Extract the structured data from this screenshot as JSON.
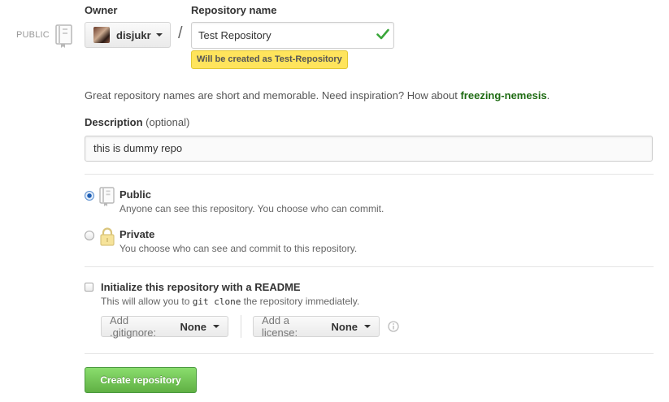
{
  "header": {
    "visibility_badge": "PUBLIC",
    "owner_label": "Owner",
    "repo_name_label": "Repository name",
    "owner_name": "disjukr",
    "slash": "/"
  },
  "repo_name": {
    "value": "Test Repository",
    "tooltip": "Will be created as Test-Repository",
    "valid": true
  },
  "hint": {
    "text": "Great repository names are short and memorable. Need inspiration? How about ",
    "suggestion": "freezing-nemesis",
    "end": "."
  },
  "description": {
    "label": "Description",
    "optional": "(optional)",
    "value": "this is dummy repo"
  },
  "visibility": {
    "public_title": "Public",
    "public_sub": "Anyone can see this repository. You choose who can commit.",
    "private_title": "Private",
    "private_sub": "You choose who can see and commit to this repository.",
    "selected": "Public"
  },
  "readme": {
    "title": "Initialize this repository with a README",
    "sub_before": "This will allow you to ",
    "sub_code": "git clone",
    "sub_after": " the repository immediately.",
    "checked": false
  },
  "gitignore": {
    "label": "Add .gitignore:",
    "value": "None"
  },
  "license": {
    "label": "Add a license:",
    "value": "None"
  },
  "submit": {
    "label": "Create repository"
  },
  "colors": {
    "accent_green": "#60b044",
    "suggestion_green": "#1e6b12",
    "tooltip_yellow": "#ffe45c"
  },
  "icons": {
    "repo": "repo-book-icon",
    "lock": "lock-icon",
    "check": "check-icon",
    "info": "info-icon"
  }
}
